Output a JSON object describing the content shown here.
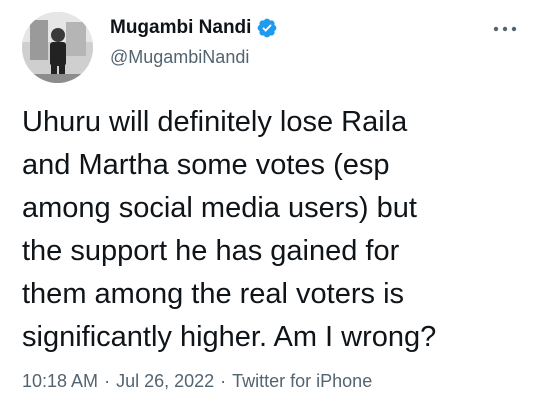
{
  "author": {
    "display_name": "Mugambi Nandi",
    "handle": "@MugambiNandi",
    "verified": true,
    "avatar_icon": "profile-photo"
  },
  "menu": {
    "icon": "more-options-icon"
  },
  "tweet": {
    "lines": [
      "Uhuru will definitely lose Raila",
      "and Martha some votes (esp",
      "among social media users) but",
      "the support he has gained for",
      "them among the real voters is",
      "significantly higher. Am I wrong?"
    ]
  },
  "meta": {
    "time": "10:18 AM",
    "separator": "·",
    "date": "Jul 26, 2022",
    "source": "Twitter for iPhone"
  },
  "colors": {
    "text": "#0f1419",
    "secondary": "#536471",
    "verified_badge": "#1d9bf0"
  }
}
